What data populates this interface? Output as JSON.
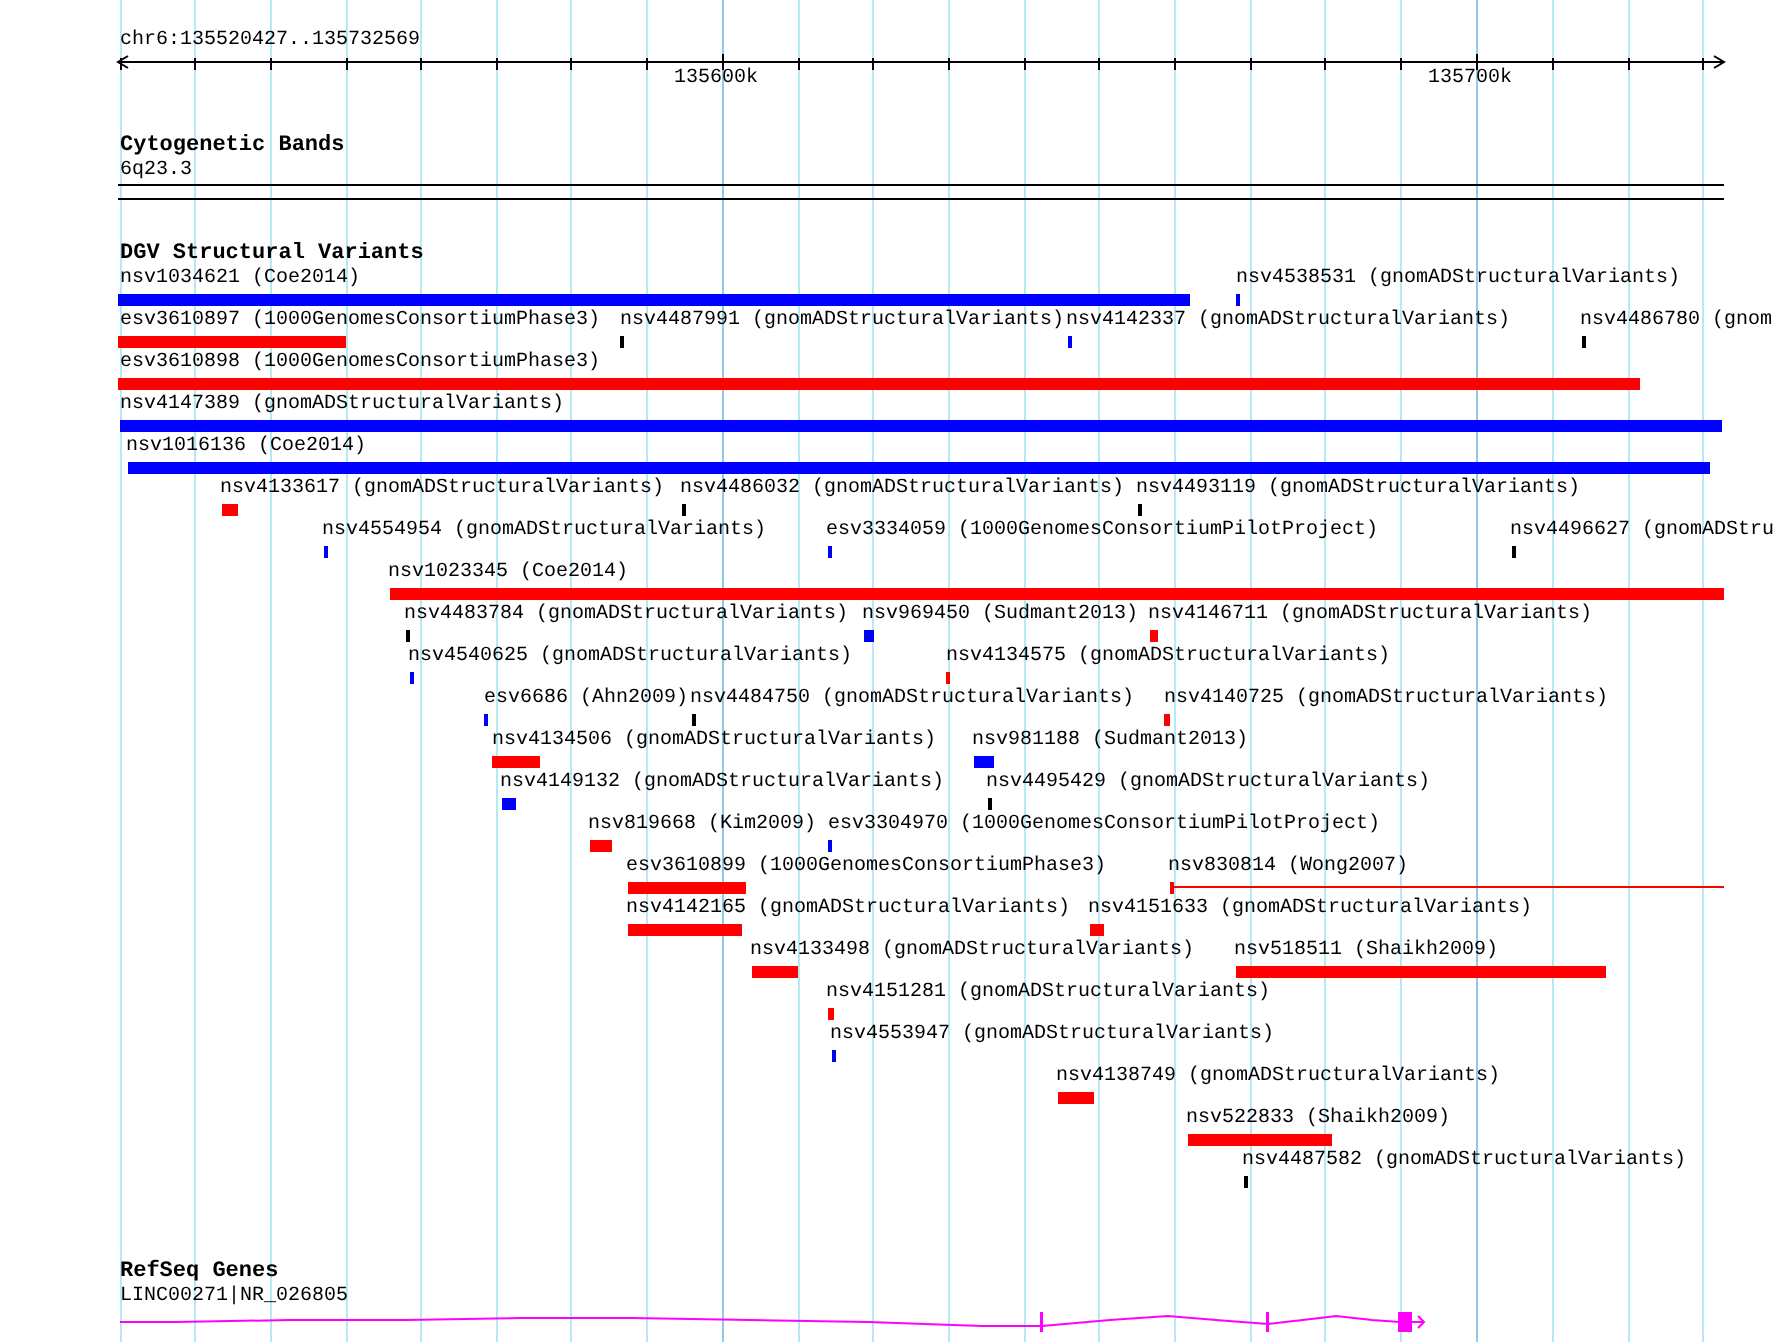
{
  "ruler": {
    "location": "chr6:135520427..135732569",
    "ticks": [
      "135600k",
      "135700k"
    ]
  },
  "tracks": [
    {
      "kind": "bands",
      "title": "Cytogenetic Bands",
      "band": "6q23.3"
    },
    {
      "kind": "variants",
      "title": "DGV Structural Variants",
      "features": [
        {
          "label": "nsv1034621 (Coe2014)",
          "color": "#0000ff",
          "kind": "bar"
        },
        {
          "label": "nsv4538531 (gnomADStructuralVariants)",
          "color": "#0000ff",
          "kind": "bar"
        },
        {
          "label": "esv3610897 (1000GenomesConsortiumPhase3)",
          "color": "#ff0000",
          "kind": "bar"
        },
        {
          "label": "nsv4487991 (gnomADStructuralVariants)",
          "color": "#000000",
          "kind": "bar"
        },
        {
          "label": "nsv4142337 (gnomADStructuralVariants)",
          "color": "#0000ff",
          "kind": "bar"
        },
        {
          "label": "nsv4486780 (gnom",
          "color": "#000000",
          "kind": "bar"
        },
        {
          "label": "esv3610898 (1000GenomesConsortiumPhase3)",
          "color": "#ff0000",
          "kind": "bar"
        },
        {
          "label": "nsv4147389 (gnomADStructuralVariants)",
          "color": "#0000ff",
          "kind": "bar"
        },
        {
          "label": "nsv1016136 (Coe2014)",
          "color": "#0000ff",
          "kind": "bar"
        },
        {
          "label": "nsv4133617 (gnomADStructuralVariants)",
          "color": "#ff0000",
          "kind": "bar"
        },
        {
          "label": "nsv4486032 (gnomADStructuralVariants)",
          "color": "#000000",
          "kind": "bar"
        },
        {
          "label": "nsv4493119 (gnomADStructuralVariants)",
          "color": "#000000",
          "kind": "bar"
        },
        {
          "label": "nsv4554954 (gnomADStructuralVariants)",
          "color": "#0000ff",
          "kind": "bar"
        },
        {
          "label": "esv3334059 (1000GenomesConsortiumPilotProject)",
          "color": "#0000ff",
          "kind": "bar"
        },
        {
          "label": "nsv4496627 (gnomADStru",
          "color": "#000000",
          "kind": "bar"
        },
        {
          "label": "nsv1023345 (Coe2014)",
          "color": "#ff0000",
          "kind": "bar"
        },
        {
          "label": "nsv4483784 (gnomADStructuralVariants)",
          "color": "#000000",
          "kind": "bar"
        },
        {
          "label": "nsv969450 (Sudmant2013)",
          "color": "#0000ff",
          "kind": "bar"
        },
        {
          "label": "nsv4146711 (gnomADStructuralVariants)",
          "color": "#ff0000",
          "kind": "bar"
        },
        {
          "label": "nsv4540625 (gnomADStructuralVariants)",
          "color": "#0000ff",
          "kind": "bar"
        },
        {
          "label": "nsv4134575 (gnomADStructuralVariants)",
          "color": "#ff0000",
          "kind": "bar"
        },
        {
          "label": "esv6686 (Ahn2009)",
          "color": "#0000ff",
          "kind": "bar"
        },
        {
          "label": "nsv4484750 (gnomADStructuralVariants)",
          "color": "#000000",
          "kind": "bar"
        },
        {
          "label": "nsv4140725 (gnomADStructuralVariants)",
          "color": "#ff0000",
          "kind": "bar"
        },
        {
          "label": "nsv4134506 (gnomADStructuralVariants)",
          "color": "#ff0000",
          "kind": "bar"
        },
        {
          "label": "nsv981188 (Sudmant2013)",
          "color": "#0000ff",
          "kind": "bar"
        },
        {
          "label": "nsv4149132 (gnomADStructuralVariants)",
          "color": "#0000ff",
          "kind": "bar"
        },
        {
          "label": "nsv4495429 (gnomADStructuralVariants)",
          "color": "#000000",
          "kind": "bar"
        },
        {
          "label": "nsv819668 (Kim2009)",
          "color": "#ff0000",
          "kind": "bar"
        },
        {
          "label": "esv3304970 (1000GenomesConsortiumPilotProject)",
          "color": "#0000ff",
          "kind": "bar"
        },
        {
          "label": "esv3610899 (1000GenomesConsortiumPhase3)",
          "color": "#ff0000",
          "kind": "bar"
        },
        {
          "label": "nsv830814 (Wong2007)",
          "color": "#ff0000",
          "kind": "line"
        },
        {
          "label": "nsv4142165 (gnomADStructuralVariants)",
          "color": "#ff0000",
          "kind": "bar"
        },
        {
          "label": "nsv4151633 (gnomADStructuralVariants)",
          "color": "#ff0000",
          "kind": "bar"
        },
        {
          "label": "nsv4133498 (gnomADStructuralVariants)",
          "color": "#ff0000",
          "kind": "bar"
        },
        {
          "label": "nsv518511 (Shaikh2009)",
          "color": "#ff0000",
          "kind": "bar"
        },
        {
          "label": "nsv4151281 (gnomADStructuralVariants)",
          "color": "#ff0000",
          "kind": "bar"
        },
        {
          "label": "nsv4553947 (gnomADStructuralVariants)",
          "color": "#0000ff",
          "kind": "bar"
        },
        {
          "label": "nsv4138749 (gnomADStructuralVariants)",
          "color": "#ff0000",
          "kind": "bar"
        },
        {
          "label": "nsv522833 (Shaikh2009)",
          "color": "#ff0000",
          "kind": "bar"
        },
        {
          "label": "nsv4487582 (gnomADStructuralVariants)",
          "color": "#000000",
          "kind": "bar"
        }
      ]
    },
    {
      "kind": "genes",
      "title": "RefSeq Genes",
      "gene": "LINC00271|NR_026805"
    }
  ]
}
